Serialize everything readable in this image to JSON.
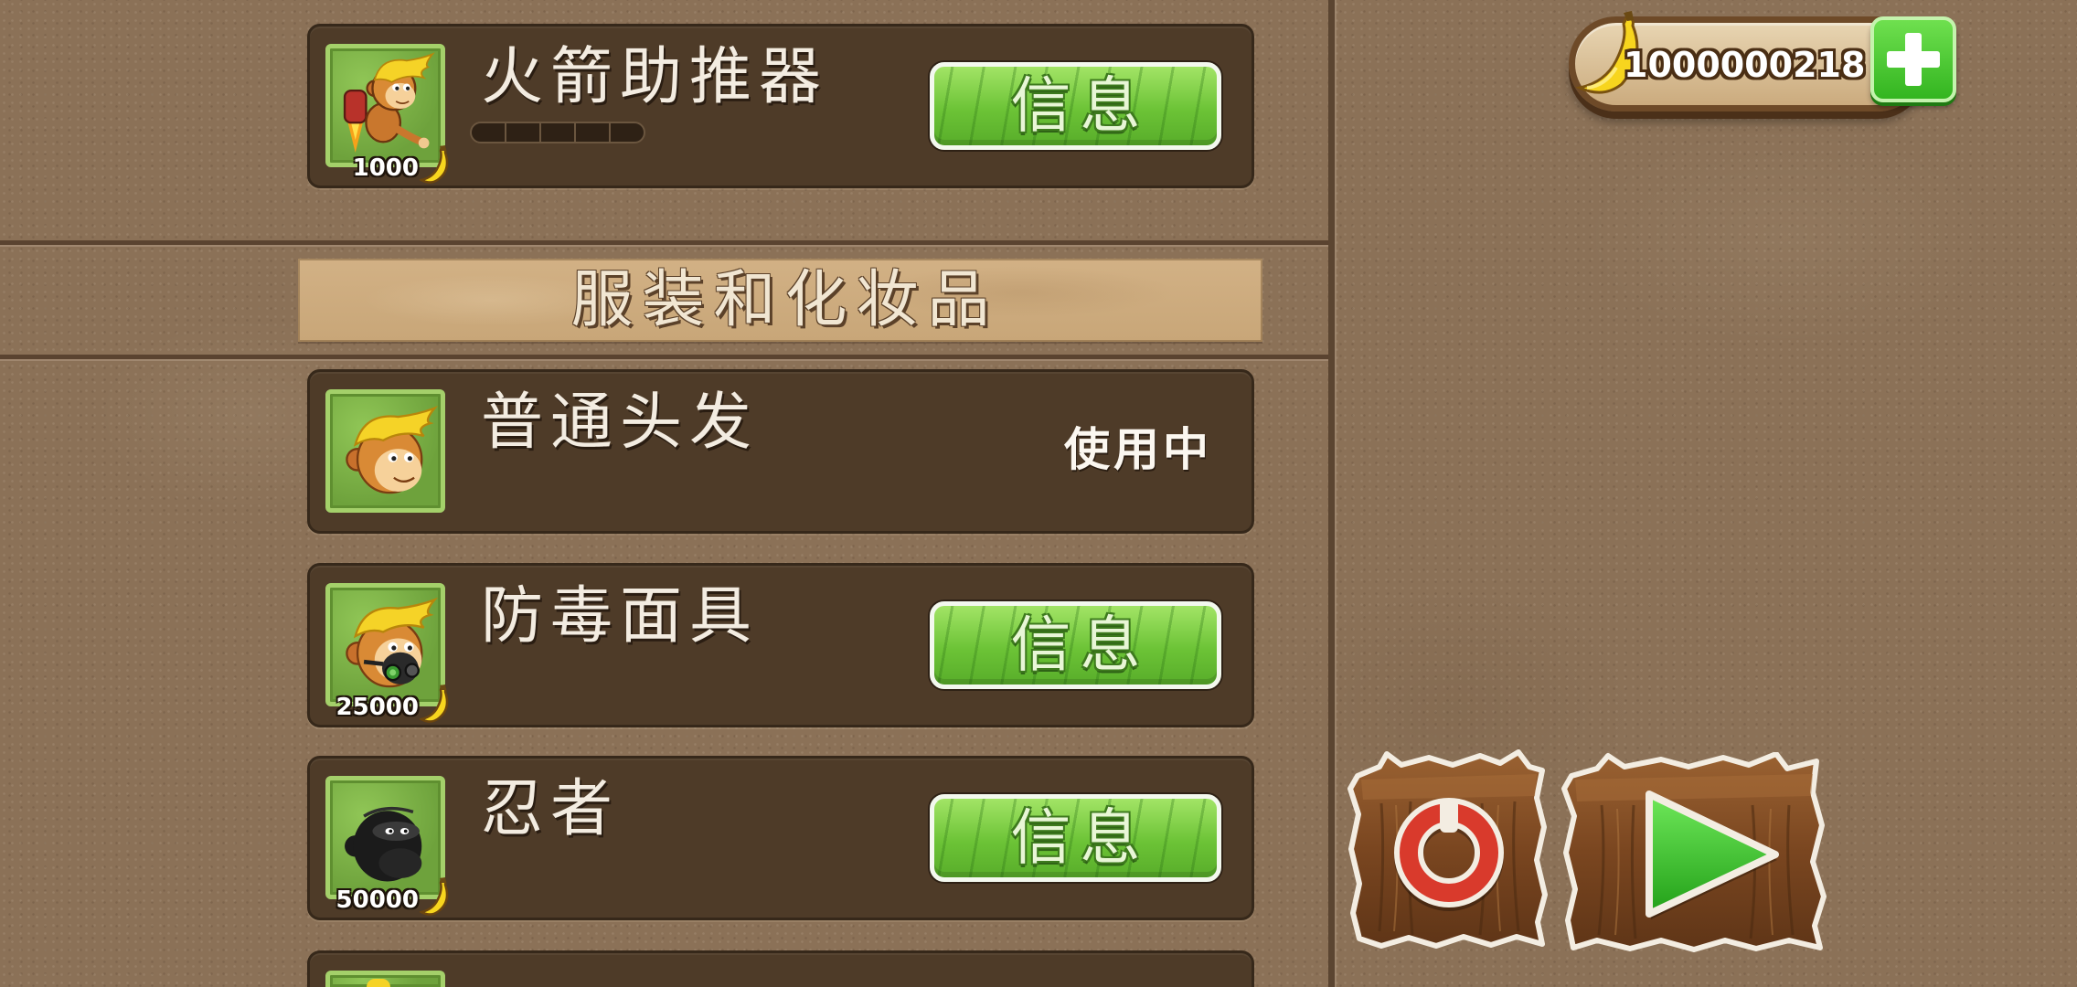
{
  "header": {
    "coins": "1000000218",
    "coin_icon": "banana-icon",
    "add_icon": "plus-icon"
  },
  "upgrades": [
    {
      "title": "火箭助推器",
      "icon": "rocket-booster-monkey-icon",
      "price": "1000",
      "price_icon": "banana-icon",
      "button": "信息",
      "upgrade_level": 0,
      "upgrade_segments": 5
    }
  ],
  "section": {
    "title": "服装和化妆品"
  },
  "costumes": [
    {
      "title": "普通头发",
      "icon": "normal-hair-monkey-icon",
      "status": "使用中"
    },
    {
      "title": "防毒面具",
      "icon": "gas-mask-monkey-icon",
      "price": "25000",
      "price_icon": "banana-icon",
      "button": "信息"
    },
    {
      "title": "忍者",
      "icon": "ninja-monkey-icon",
      "price": "50000",
      "price_icon": "banana-icon",
      "button": "信息"
    },
    {
      "icon": "monkey-icon"
    }
  ],
  "controls": {
    "restart_icon": "power-icon",
    "play_icon": "play-icon"
  },
  "colors": {
    "background": "#8b7157",
    "panel": "#4e3b28",
    "section_header": "#c8a678",
    "button_green": "#6cc336",
    "power_red": "#d93a2c",
    "play_green": "#3ccf2b",
    "banana_yellow": "#f7d51e"
  }
}
